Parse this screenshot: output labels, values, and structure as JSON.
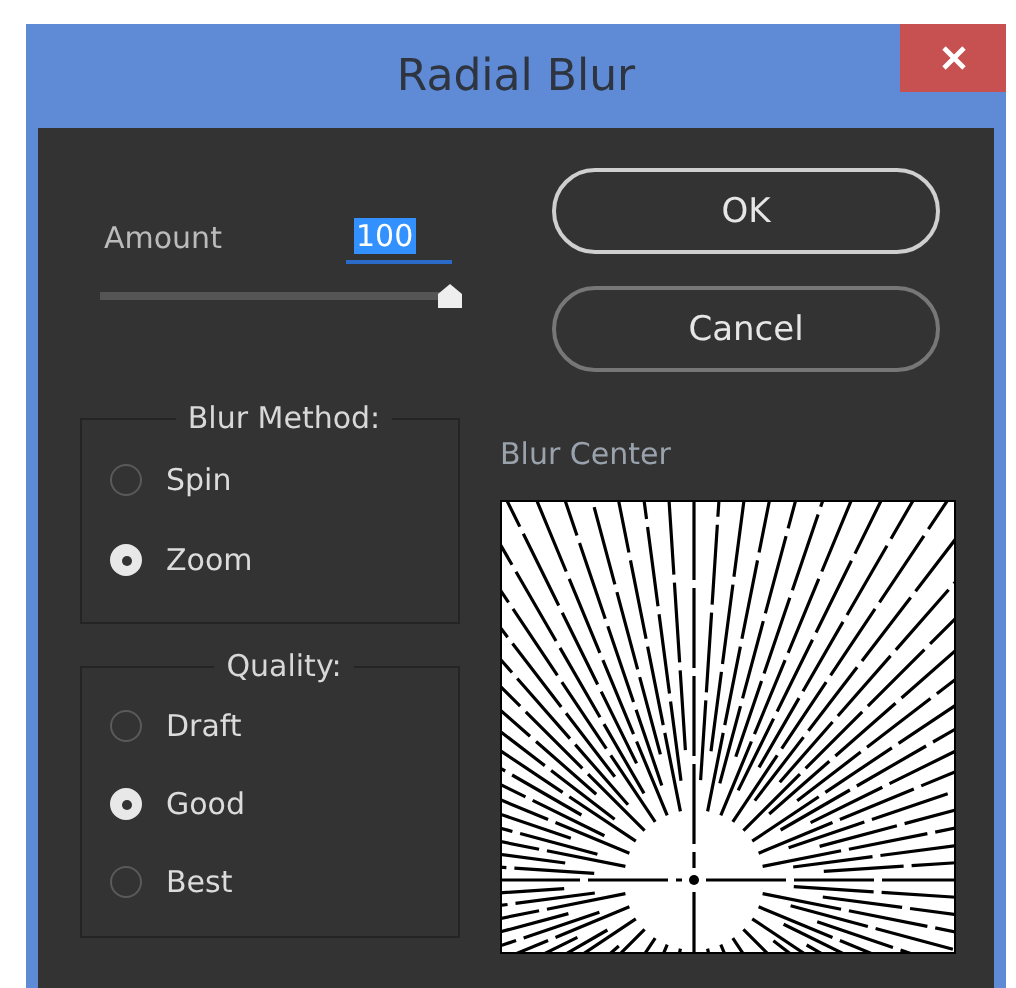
{
  "window": {
    "title": "Radial Blur"
  },
  "amount": {
    "label": "Amount",
    "value": "100",
    "level": 1
  },
  "buttons": [
    {
      "label": "OK"
    },
    {
      "label": "Cancel"
    }
  ],
  "blur_method": {
    "title": "Blur Method:",
    "options": [
      {
        "label": "Spin",
        "selected": false
      },
      {
        "label": "Zoom",
        "selected": true
      }
    ]
  },
  "quality": {
    "title": "Quality:",
    "options": [
      {
        "label": "Draft",
        "selected": false
      },
      {
        "label": "Good",
        "selected": true
      },
      {
        "label": "Best",
        "selected": false
      }
    ]
  },
  "blur_center": {
    "label": "Blur Center"
  }
}
